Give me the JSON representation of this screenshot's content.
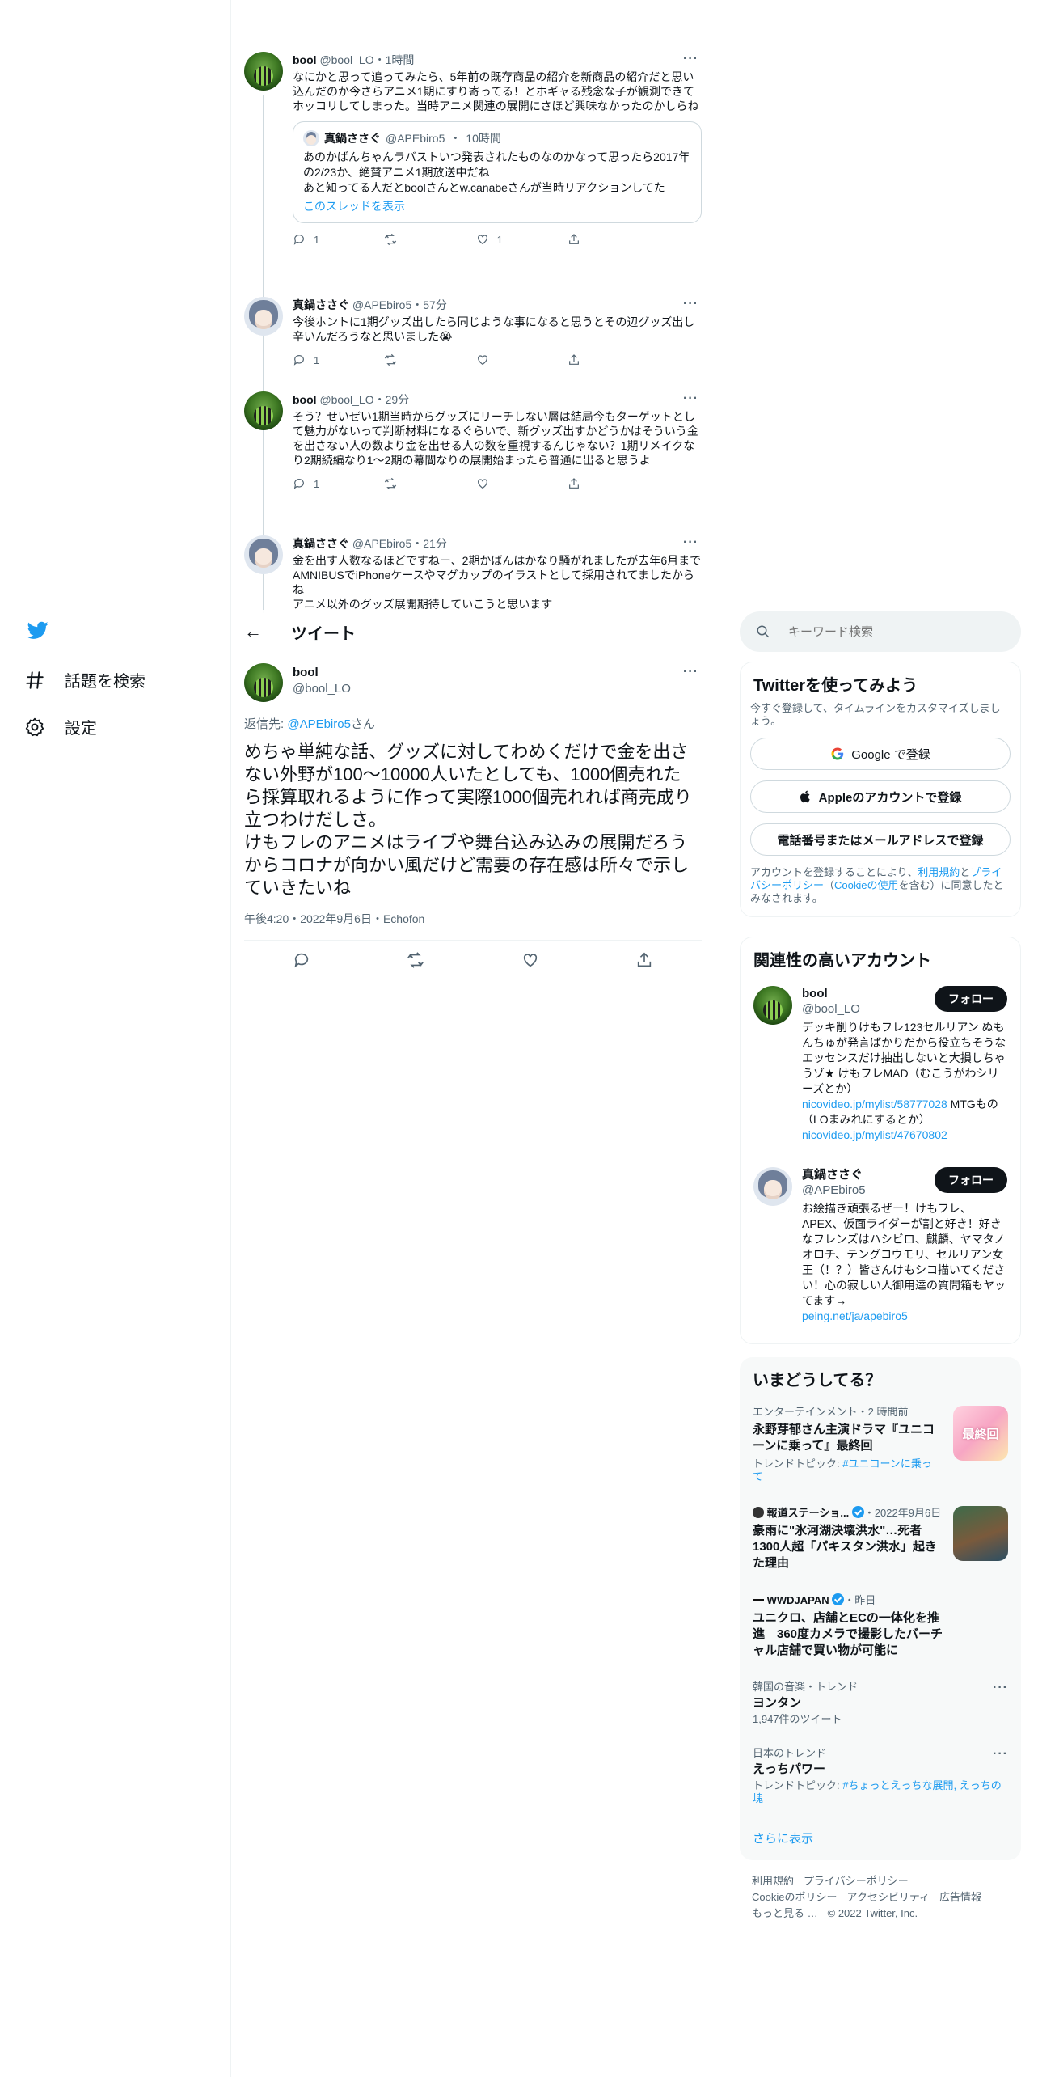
{
  "nav": {
    "items": [
      {
        "label": "話題を検索",
        "icon": "hashtag-icon"
      },
      {
        "label": "設定",
        "icon": "gear-icon"
      }
    ]
  },
  "thread": [
    {
      "name": "bool",
      "handle": "@bool_LO",
      "time": "1時間",
      "text": "なにかと思って追ってみたら、5年前の既存商品の紹介を新商品の紹介だと思い込んだのか今さらアニメ1期にすり寄ってる！とホギャる残念な子が観測できてホッコリしてしまった。当時アニメ関連の展開にさほど興味なかったのかしらね",
      "quote": {
        "name": "真鍋ささぐ",
        "handle": "@APEbiro5",
        "time": "10時間",
        "text": "あのかばんちゃんラバストいつ発表されたものなのかなって思ったら2017年の2/23か、絶賛アニメ1期放送中だね\nあと知ってる人だとboolさんとw.canabeさんが当時リアクションしてた",
        "show_thread": "このスレッドを表示"
      },
      "replies": "1",
      "retweets": "",
      "likes": "1"
    },
    {
      "name": "真鍋ささぐ",
      "handle": "@APEbiro5",
      "time": "57分",
      "text": "今後ホントに1期グッズ出したら同じような事になると思うとその辺グッズ出し辛いんだろうなと思いました😭",
      "replies": "1",
      "retweets": "",
      "likes": ""
    },
    {
      "name": "bool",
      "handle": "@bool_LO",
      "time": "29分",
      "text": "そう？せいぜい1期当時からグッズにリーチしない層は結局今もターゲットとして魅力がないって判断材料になるぐらいで、新グッズ出すかどうかはそういう金を出さない人の数より金を出せる人の数を重視するんじゃない？1期リメイクなり2期続編なり1〜2期の幕間なりの展開始まったら普通に出ると思うよ",
      "replies": "1",
      "retweets": "",
      "likes": ""
    },
    {
      "name": "真鍋ささぐ",
      "handle": "@APEbiro5",
      "time": "21分",
      "text": "金を出す人数なるほどですねー、2期かばんはかなり騒がれましたが去年6月までAMNIBUSでiPhoneケースやマグカップのイラストとして採用されてましたからね\nアニメ以外のグッズ展開期待していこうと思います"
    }
  ],
  "header": {
    "back": "←",
    "title": "ツイート"
  },
  "main_tweet": {
    "name": "bool",
    "handle": "@bool_LO",
    "reply_prefix": "返信先: ",
    "reply_to": "@APEbiro5",
    "reply_suffix": "さん",
    "text": "めちゃ単純な話、グッズに対してわめくだけで金を出さない外野が100〜10000人いたとしても、1000個売れたら採算取れるように作って実際1000個売れれば商売成り立つわけだしさ。\nけもフレのアニメはライブや舞台込み込みの展開だろうからコロナが向かい風だけど需要の存在感は所々で示していきたいね",
    "meta": "午後4:20・2022年9月6日・Echofon"
  },
  "search": {
    "placeholder": "キーワード検索"
  },
  "signup": {
    "title": "Twitterを使ってみよう",
    "subtitle": "今すぐ登録して、タイムラインをカスタマイズしましょう。",
    "google": "Google で登録",
    "apple": "Appleのアカウントで登録",
    "phone": "電話番号またはメールアドレスで登録",
    "legal_1": "アカウントを登録することにより、",
    "legal_terms": "利用規約",
    "legal_2": "と",
    "legal_privacy": "プライバシーポリシー",
    "legal_3": "（",
    "legal_cookie": "Cookieの使用",
    "legal_4": "を含む）に同意したとみなされます。"
  },
  "related": {
    "title": "関連性の高いアカウント",
    "follow_label": "フォロー",
    "accounts": [
      {
        "name": "bool",
        "handle": "@bool_LO",
        "bio": "デッキ削りけもフレ123セルリアン ぬもんちゅが発言ばかりだから役立ちそうなエッセンスだけ抽出しないと大損しちゃうゾ★ けもフレMAD（むこうがわシリーズとか）",
        "link1": "nicovideo.jp/mylist/58777028",
        "mid": " MTGもの（LOまみれにするとか）",
        "link2": "nicovideo.jp/mylist/47670802"
      },
      {
        "name": "真鍋ささぐ",
        "handle": "@APEbiro5",
        "bio": "お絵描き頑張るぜー！けもフレ、APEX、仮面ライダーが割と好き！好きなフレンズはハシビロ、麒麟、ヤマタノオロチ、テングコウモリ、セルリアン女王（！？）皆さんけもシコ描いてください！心の寂しい人御用達の質問箱もヤッてます→",
        "link1": "peing.net/ja/apebiro5"
      }
    ]
  },
  "trends": {
    "title": "いまどうしてる？",
    "items": [
      {
        "meta": "エンターテインメント・2 時間前",
        "title": "永野芽郁さん主演ドラマ『ユニコーンに乗って』最終回",
        "topic_prefix": "トレンドトピック: ",
        "topic": "#ユニコーンに乗って",
        "thumb_text": "最終回"
      },
      {
        "source": "報道ステーショ...",
        "date": "・2022年9月6日",
        "title": "豪雨に\"氷河湖決壊洪水\"…死者1300人超「パキスタン洪水」起きた理由"
      },
      {
        "source": "WWDJAPAN",
        "date": "・昨日",
        "title": "ユニクロ、店舗とECの一体化を推進　360度カメラで撮影したバーチャル店舗で買い物が可能に"
      },
      {
        "meta": "韓国の音楽・トレンド",
        "title": "ヨンタン",
        "count": "1,947件のツイート"
      },
      {
        "meta": "日本のトレンド",
        "title": "えっちパワー",
        "topic_prefix": "トレンドトピック: ",
        "topic": "#ちょっとえっちな展開, えっちの塊"
      }
    ],
    "show_more": "さらに表示"
  },
  "footer": {
    "links": [
      "利用規約",
      "プライバシーポリシー",
      "Cookieのポリシー",
      "アクセシビリティ",
      "広告情報",
      "もっと見る …"
    ],
    "copyright": "© 2022 Twitter, Inc."
  },
  "colors": {
    "accent": "#1d9bf0",
    "text": "#0f1419",
    "secondary": "#536471",
    "border": "#eff3f4"
  }
}
